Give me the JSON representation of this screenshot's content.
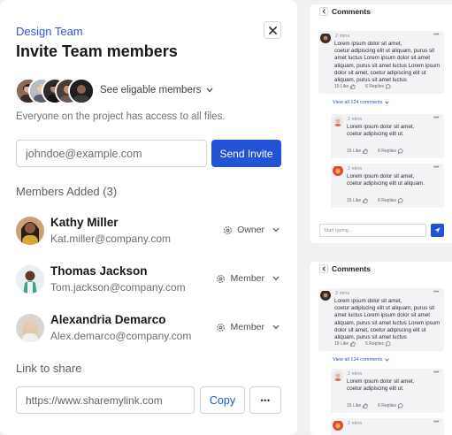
{
  "modal": {
    "eyebrow": "Design Team",
    "title": "Invite Team members",
    "see_eligible": "See eligable members",
    "access_note": "Everyone on the project has access to all files.",
    "email_placeholder": "johndoe@example.com",
    "send_label": "Send Invite",
    "members_heading": "Members Added (3)",
    "members": [
      {
        "name": "Kathy Miller",
        "email": "Kat.miller@company.com",
        "role": "Owner"
      },
      {
        "name": "Thomas Jackson",
        "email": "Tom.jackson@company.com",
        "role": "Member"
      },
      {
        "name": "Alexandria Demarco",
        "email": "Alex.demarco@company.com",
        "role": "Member"
      }
    ],
    "link_heading": "Link to share",
    "link_value": "https://www.sharemylink.com",
    "copy_label": "Copy",
    "more_label": "•••"
  },
  "comments_panels": [
    {
      "title": "Comments",
      "main_comment": {
        "time": "2 mins",
        "text_lines": [
          "Lorem ipsum dolor sit amet,",
          "coetur adipiscing elit ut aliquam, purus sit",
          "amet luctus Lorem ipsum dolor sit amet",
          "aliquam, purus sit amet luctus Lorem ipsum",
          "dolor sit amet, coetur adipiscing elit ut",
          "aliquam, purus sit amet luctus"
        ],
        "likes": "15 Like",
        "replies": "6 Replies"
      },
      "view_all": "View all 124 comments",
      "replies": [
        {
          "time": "2 mins",
          "text_lines": [
            "Lorem ipsum dolor sit amet,",
            "coetur adipiscing elit ut."
          ],
          "likes": "15 Like",
          "replies": "6 Replies"
        },
        {
          "time": "2 mins",
          "text_lines": [
            "Lorem ipsum dolor sit amet,",
            "coetur adipiscing elit ut aliquam."
          ],
          "likes": "15 Like",
          "replies": "6 Replies"
        }
      ],
      "input_placeholder": "Start typing..."
    },
    {
      "title": "Comments",
      "main_comment": {
        "time": "2 mins",
        "text_lines": [
          "Lorem ipsum dolor sit amet,",
          "coetur adipiscing elit ut aliquam, purus sit",
          "amet luctus Lorem ipsum dolor sit amet",
          "aliquam, purus sit amet luctus Lorem ipsum",
          "dolor sit amet, coetur adipiscing elit ut",
          "aliquam, purus sit amet luctus"
        ],
        "likes": "15 Like",
        "replies": "5 Replies"
      },
      "view_all": "View all 124 comments",
      "replies": [
        {
          "time": "2 mins",
          "text_lines": [
            "Lorem ipsum dolor sit amet,",
            "coetur adipiscing elit ut."
          ],
          "likes": "15 Like",
          "replies": "6 Replies"
        },
        {
          "time": "2 mins",
          "text_lines": [],
          "likes": "",
          "replies": ""
        }
      ]
    }
  ],
  "colors": {
    "accent": "#2452d4",
    "eyebrow": "#2c56d6",
    "card_bg": "#f2f3f5",
    "page_bg": "#f1f1f3"
  },
  "icons": {
    "close": "close-icon",
    "chevron": "chevron-down-icon",
    "role": "gear-icon",
    "like": "thumb-up-icon",
    "reply": "chat-bubble-icon",
    "back": "chevron-left-icon",
    "send": "paper-plane-icon"
  }
}
